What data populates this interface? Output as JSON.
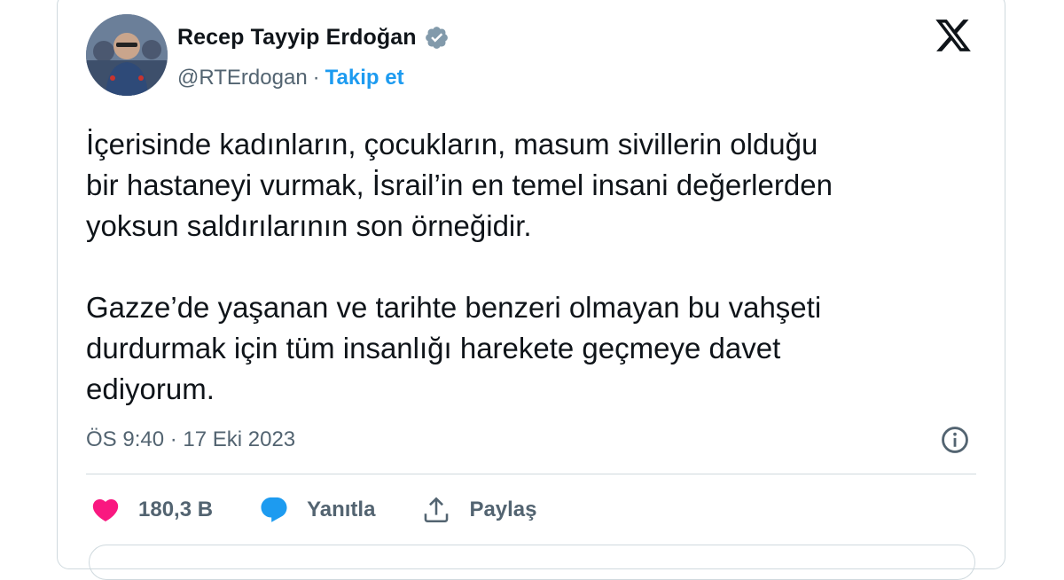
{
  "author": {
    "name": "Recep Tayyip Erdoğan",
    "handle": "@RTErdogan",
    "separator": "·",
    "follow_label": "Takip et",
    "verified_color": "#829aab"
  },
  "tweet": {
    "paragraphs": [
      "İçerisinde kadınların, çocukların, masum sivillerin olduğu\nbir hastaneyi vurmak, İsrail’in en temel insani değerlerden\nyoksun saldırılarının son örneğidir.",
      "Gazze’de yaşanan ve tarihte benzeri olmayan bu vahşeti\ndurdurmak için tüm insanlığı harekete geçmeye davet\nediyorum."
    ],
    "timestamp": "ÖS 9:40 · 17 Eki 2023"
  },
  "actions": {
    "like_count": "180,3 B",
    "reply_label": "Yanıtla",
    "share_label": "Paylaş"
  },
  "colors": {
    "like": "#f91880",
    "reply": "#1d9bf0",
    "link": "#1d9bf0",
    "muted": "#536471"
  },
  "icons": [
    "x-logo-icon",
    "verified-badge-icon",
    "info-icon",
    "heart-icon",
    "reply-bubble-icon",
    "share-icon"
  ]
}
